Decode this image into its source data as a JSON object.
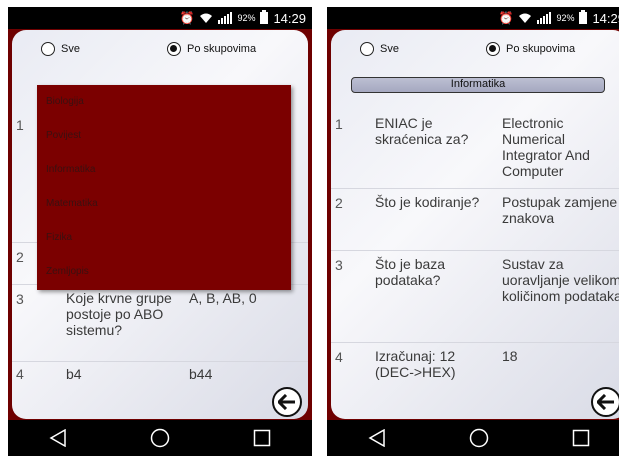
{
  "status": {
    "battery": "92%",
    "time": "14:29"
  },
  "filter": {
    "option_all": "Sve",
    "option_groups": "Po skupovima"
  },
  "left": {
    "dropdown": [
      "Biologija",
      "Povijest",
      "Informatika",
      "Matematika",
      "Fizika",
      "Zemljopis"
    ],
    "rows": [
      {
        "num": "1",
        "question": "",
        "answer": ""
      },
      {
        "num": "2",
        "question": "",
        "answer": "a"
      },
      {
        "num": "3",
        "question": "Koje krvne grupe postoje po ABO sistemu?",
        "answer": "A, B, AB, 0"
      },
      {
        "num": "4",
        "question": "b4",
        "answer": "b44"
      }
    ]
  },
  "right": {
    "category": "Informatika",
    "rows": [
      {
        "num": "1",
        "question": "ENIAC je skraćenica za?",
        "answer": "Electronic Numerical Integrator And Computer"
      },
      {
        "num": "2",
        "question": "Što je kodiranje?",
        "answer": "Postupak zamjene znakova"
      },
      {
        "num": "3",
        "question": "Što je baza podataka?",
        "answer": "Sustav za uoravljanje velikom količinom podataka"
      },
      {
        "num": "4",
        "question": "Izračunaj: 12 (DEC->HEX)",
        "answer": "18"
      }
    ]
  },
  "icons": {
    "alarm": "alarm-icon",
    "wifi": "wifi-icon",
    "signal": "signal-icon",
    "battery": "battery-icon",
    "back_button": "arrow-left-icon",
    "nav_back": "nav-back-icon",
    "nav_home": "nav-home-icon",
    "nav_recents": "nav-recents-icon"
  },
  "colors": {
    "frame": "#6e0000",
    "dropdown": "#7b0000",
    "category_bar": "#b0b3c8"
  }
}
